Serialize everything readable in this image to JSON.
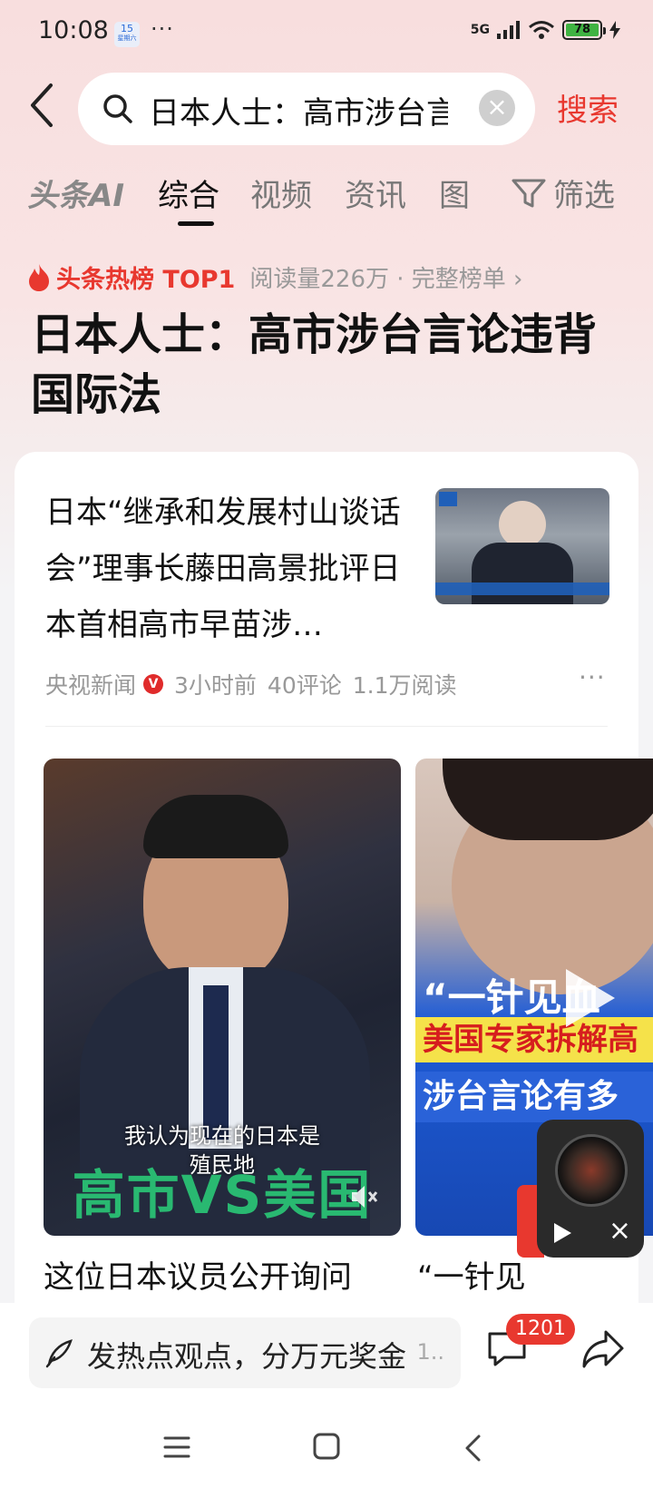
{
  "status_bar": {
    "time": "10:08",
    "badge_day": "15",
    "badge_text": "星期六",
    "dots": "···",
    "signal": "5G",
    "battery": "78"
  },
  "search": {
    "query": "日本人士：高市涉台言论违背国际法",
    "clear": "×",
    "submit": "搜索"
  },
  "tabs": [
    {
      "label": "头条AI"
    },
    {
      "label": "综合"
    },
    {
      "label": "视频"
    },
    {
      "label": "资讯"
    },
    {
      "label": "图"
    }
  ],
  "filter_label": "筛选",
  "hot": {
    "tag": "头条热榜 TOP1",
    "meta": "阅读量226万 · 完整榜单 ›",
    "title": "日本人士：高市涉台言论违背国际法"
  },
  "article": {
    "title": "日本“继承和发展村山谈话会”理事长藤田高景批评日本首相高市早苗涉…",
    "source": "央视新闻",
    "verified": "V",
    "time_ago": "3小时前",
    "comments": "40评论",
    "reads": "1.1万阅读",
    "more": "···"
  },
  "videos": [
    {
      "subtitle_line1": "我认为现在的日本是",
      "subtitle_line2": "殖民地",
      "overlay": "高市VS美国",
      "caption": "这位日本议员公开询问"
    },
    {
      "line1": "“一针见血",
      "line2": "美国专家拆解高",
      "line3": "涉台言论有多",
      "caption": "“一针见"
    }
  ],
  "mini_player": {
    "close": "×"
  },
  "bottom": {
    "comment_placeholder": "发热点观点，分万元奖金",
    "comment_more": "1..",
    "comment_count": "1201"
  },
  "colors": {
    "accent": "#e8382f",
    "text_primary": "#111111",
    "text_secondary": "#999999"
  }
}
